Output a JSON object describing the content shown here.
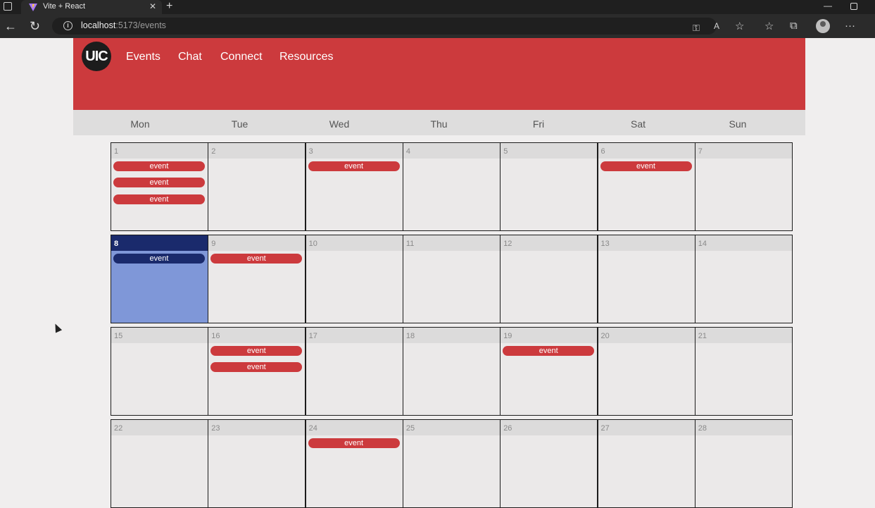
{
  "browser": {
    "tab_title": "Vite + React",
    "url_host": "localhost",
    "url_rest": ":5173/events"
  },
  "header": {
    "logo_text": "UIC",
    "nav": [
      "Events",
      "Chat",
      "Connect",
      "Resources"
    ]
  },
  "weekdays": [
    "Mon",
    "Tue",
    "Wed",
    "Thu",
    "Fri",
    "Sat",
    "Sun"
  ],
  "calendar": {
    "today": 8,
    "weeks": [
      [
        {
          "day": "1",
          "events": [
            "event",
            "event",
            "event"
          ]
        },
        {
          "day": "2",
          "events": []
        },
        {
          "day": "3",
          "events": [
            "event"
          ]
        },
        {
          "day": "4",
          "events": []
        },
        {
          "day": "5",
          "events": []
        },
        {
          "day": "6",
          "events": [
            "event"
          ]
        },
        {
          "day": "7",
          "events": []
        }
      ],
      [
        {
          "day": "8",
          "events": [
            "event"
          ]
        },
        {
          "day": "9",
          "events": [
            "event"
          ]
        },
        {
          "day": "10",
          "events": []
        },
        {
          "day": "11",
          "events": []
        },
        {
          "day": "12",
          "events": []
        },
        {
          "day": "13",
          "events": []
        },
        {
          "day": "14",
          "events": []
        }
      ],
      [
        {
          "day": "15",
          "events": []
        },
        {
          "day": "16",
          "events": [
            "event",
            "event"
          ]
        },
        {
          "day": "17",
          "events": []
        },
        {
          "day": "18",
          "events": []
        },
        {
          "day": "19",
          "events": [
            "event"
          ]
        },
        {
          "day": "20",
          "events": []
        },
        {
          "day": "21",
          "events": []
        }
      ],
      [
        {
          "day": "22",
          "events": []
        },
        {
          "day": "23",
          "events": []
        },
        {
          "day": "24",
          "events": [
            "event"
          ]
        },
        {
          "day": "25",
          "events": []
        },
        {
          "day": "26",
          "events": []
        },
        {
          "day": "27",
          "events": []
        },
        {
          "day": "28",
          "events": []
        }
      ]
    ]
  },
  "colors": {
    "brand_red": "#cc3a3d",
    "today_navy": "#1a2a6c",
    "today_fill": "#7f97d8"
  }
}
